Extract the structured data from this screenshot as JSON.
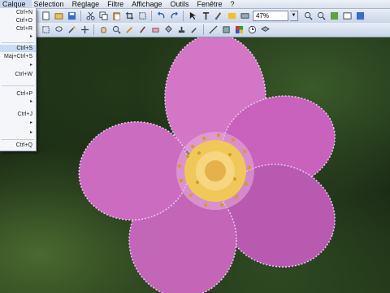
{
  "menu": {
    "items": [
      "Calque",
      "Sélection",
      "Réglage",
      "Filtre",
      "Affichage",
      "Outils",
      "Fenêtre",
      "?"
    ]
  },
  "toolbar": {
    "zoom_value": "47%"
  },
  "dropdown": {
    "shortcuts": [
      "Ctrl+N",
      "Ctrl+O",
      "Ctrl+R",
      "Ctrl+S",
      "Maj+Ctrl+S",
      "Ctrl+W",
      "Ctrl+P",
      "Ctrl+J",
      "Ctrl+Q"
    ]
  },
  "icons": {
    "toolbar1": [
      "new-icon",
      "open-icon",
      "save-icon",
      "cut-icon",
      "copy-icon",
      "paste-icon",
      "crop-icon",
      "deselect-icon",
      "undo-icon",
      "redo-icon",
      "select-icon",
      "text-icon",
      "brush-icon",
      "gradient-icon",
      "layer-icon",
      "zoom-in-icon",
      "zoom-out-icon",
      "actual-size-icon",
      "fit-icon",
      "fullscreen-icon"
    ],
    "toolbar2": [
      "rectangle-select-icon",
      "lasso-icon",
      "magic-wand-icon",
      "move-icon",
      "hand-icon",
      "zoom-icon",
      "pencil-icon",
      "paintbrush-icon",
      "eraser-icon",
      "bucket-icon",
      "stamp-icon",
      "color-picker-icon",
      "line-icon",
      "shape-icon",
      "palette-icon",
      "history-icon",
      "layers-icon"
    ]
  },
  "colors": {
    "accent": "#3a6cc8",
    "selection_highlight": "#c8dcf4"
  }
}
